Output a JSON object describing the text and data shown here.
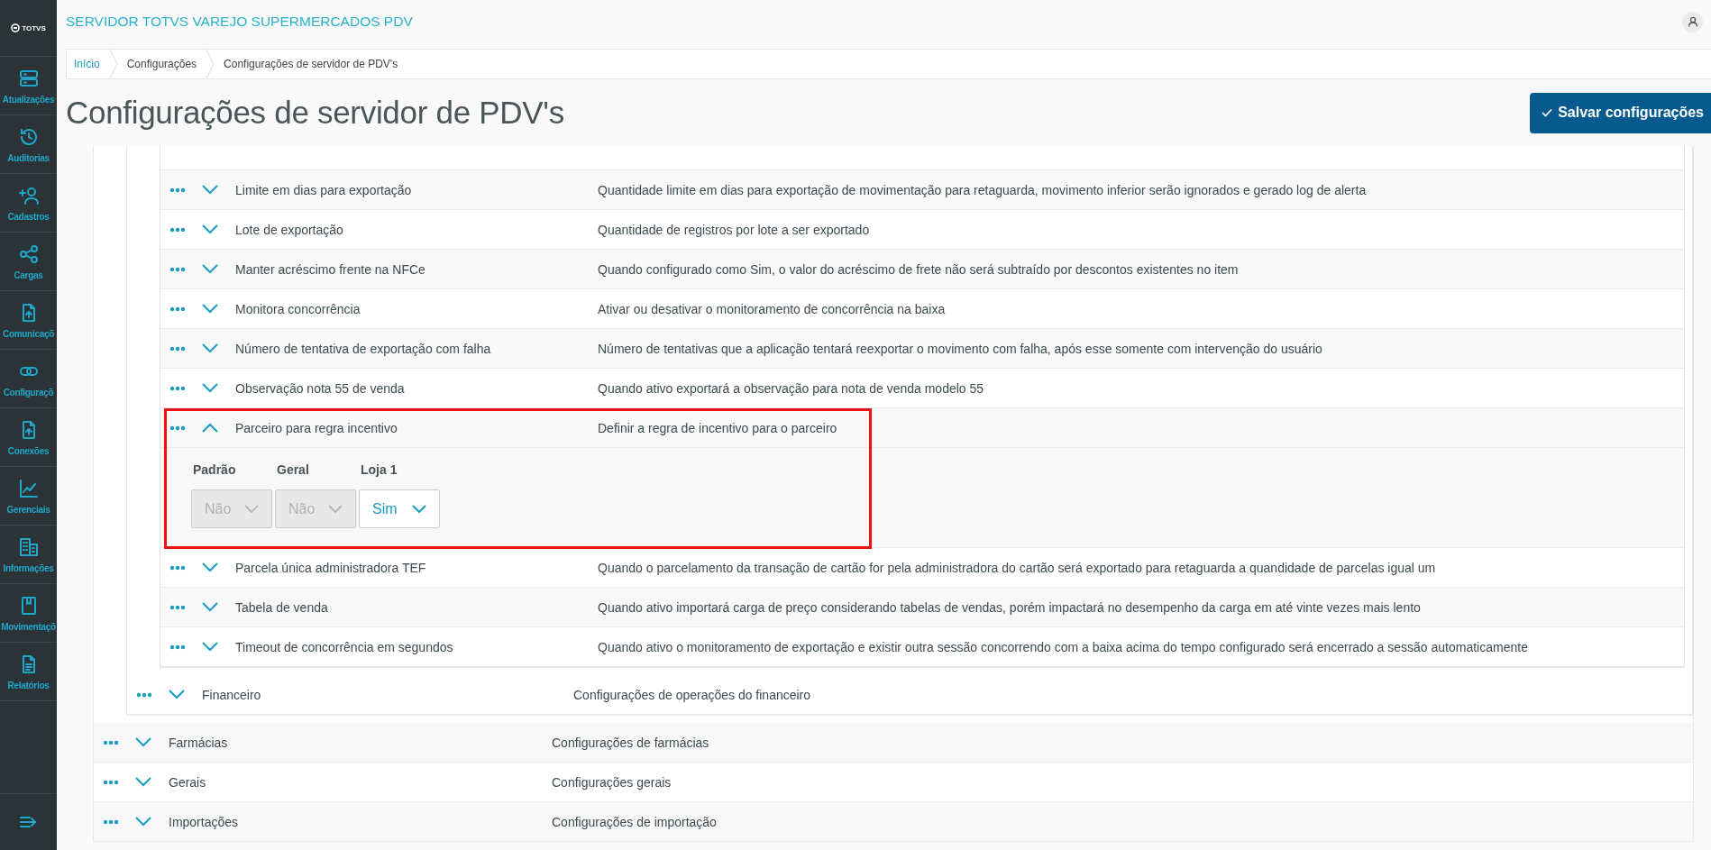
{
  "header": {
    "title": "SERVIDOR TOTVS VAREJO SUPERMERCADOS PDV"
  },
  "sidebar": {
    "logo": "TOTVS",
    "items": [
      {
        "label": "Atualizações"
      },
      {
        "label": "Auditorias"
      },
      {
        "label": "Cadastros"
      },
      {
        "label": "Cargas"
      },
      {
        "label": "Comunicaçõ"
      },
      {
        "label": "Configuraçõ"
      },
      {
        "label": "Conexões"
      },
      {
        "label": "Gerenciais"
      },
      {
        "label": "Informações"
      },
      {
        "label": "Movimentaçõ"
      },
      {
        "label": "Relatórios"
      }
    ]
  },
  "breadcrumb": [
    {
      "label": "Início",
      "link": true
    },
    {
      "label": "Configurações",
      "link": false
    },
    {
      "label": "Configurações de servidor de PDV's",
      "link": false
    }
  ],
  "page_title": "Configurações de servidor de PDV's",
  "save_button": {
    "label": "Salvar configurações"
  },
  "settings": [
    {
      "name": "Limite em dias para exportação",
      "description": "Quantidade limite em dias para exportação de movimentação para retaguarda, movimento inferior serão ignorados e gerado log de alerta",
      "expanded": false,
      "highlighted": false
    },
    {
      "name": "Lote de exportação",
      "description": "Quantidade de registros por lote a ser exportado",
      "expanded": false,
      "highlighted": false
    },
    {
      "name": "Manter acréscimo frente na NFCe",
      "description": "Quando configurado como Sim, o valor do acréscimo de frete não será subtraído por descontos existentes no item",
      "expanded": false,
      "highlighted": false
    },
    {
      "name": "Monitora concorrência",
      "description": "Ativar ou desativar o monitoramento de concorrência na baixa",
      "expanded": false,
      "highlighted": false
    },
    {
      "name": "Número de tentativa de exportação com falha",
      "description": "Número de tentativas que a aplicação tentará reexportar o movimento com falha, após esse somente com intervenção do usuário",
      "expanded": false,
      "highlighted": false
    },
    {
      "name": "Observação nota 55 de venda",
      "description": "Quando ativo exportará a observação para nota de venda modelo 55",
      "expanded": false,
      "highlighted": false
    },
    {
      "name": "Parceiro para regra incentivo",
      "description": "Definir a regra de incentivo para o parceiro",
      "expanded": true,
      "highlighted": true,
      "fields": [
        {
          "label": "Padrão",
          "value": "Não",
          "disabled": true
        },
        {
          "label": "Geral",
          "value": "Não",
          "disabled": true
        },
        {
          "label": "Loja 1",
          "value": "Sim",
          "disabled": false
        }
      ]
    },
    {
      "name": "Parcela única administradora TEF",
      "description": "Quando o parcelamento da transação de cartão for pela administradora do cartão será exportado para retaguarda a quandidade de parcelas igual um",
      "expanded": false,
      "highlighted": false
    },
    {
      "name": "Tabela de venda",
      "description": "Quando ativo importará carga de preço considerando tabelas de vendas, porém impactará no desempenho da carga em até vinte vezes mais lento",
      "expanded": false,
      "highlighted": false
    },
    {
      "name": "Timeout de concorrência em segundos",
      "description": "Quando ativo o monitoramento de exportação e existir outra sessão concorrendo com a baixa acima do tempo configurado será encerrado a sessão automaticamente",
      "expanded": false,
      "highlighted": false
    }
  ],
  "categories": [
    {
      "name": "Financeiro",
      "description": "Configurações de operações do financeiro",
      "expanded": false
    }
  ],
  "groups": [
    {
      "name": "Farmácias",
      "description": "Configurações de farmácias",
      "expanded": false
    },
    {
      "name": "Gerais",
      "description": "Configurações gerais",
      "expanded": false
    },
    {
      "name": "Importações",
      "description": "Configurações de importação",
      "expanded": false
    }
  ]
}
